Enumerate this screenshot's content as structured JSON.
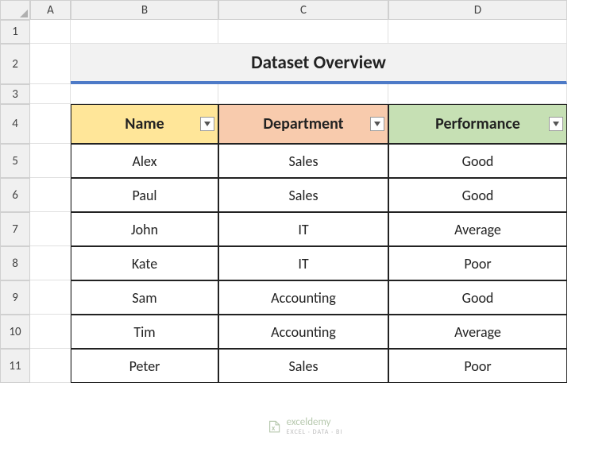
{
  "columns": [
    "A",
    "B",
    "C",
    "D"
  ],
  "rows": [
    "1",
    "2",
    "3",
    "4",
    "5",
    "6",
    "7",
    "8",
    "9",
    "10",
    "11"
  ],
  "title": "Dataset Overview",
  "headers": {
    "name": "Name",
    "department": "Department",
    "performance": "Performance"
  },
  "chart_data": {
    "type": "table",
    "title": "Dataset Overview",
    "columns": [
      "Name",
      "Department",
      "Performance"
    ],
    "rows": [
      {
        "name": "Alex",
        "department": "Sales",
        "performance": "Good"
      },
      {
        "name": "Paul",
        "department": "Sales",
        "performance": "Good"
      },
      {
        "name": "John",
        "department": "IT",
        "performance": "Average"
      },
      {
        "name": "Kate",
        "department": "IT",
        "performance": "Poor"
      },
      {
        "name": "Sam",
        "department": "Accounting",
        "performance": "Good"
      },
      {
        "name": "Tim",
        "department": "Accounting",
        "performance": "Average"
      },
      {
        "name": "Peter",
        "department": "Sales",
        "performance": "Poor"
      }
    ]
  },
  "watermark": {
    "name": "exceldemy",
    "sub": "EXCEL · DATA · BI"
  }
}
